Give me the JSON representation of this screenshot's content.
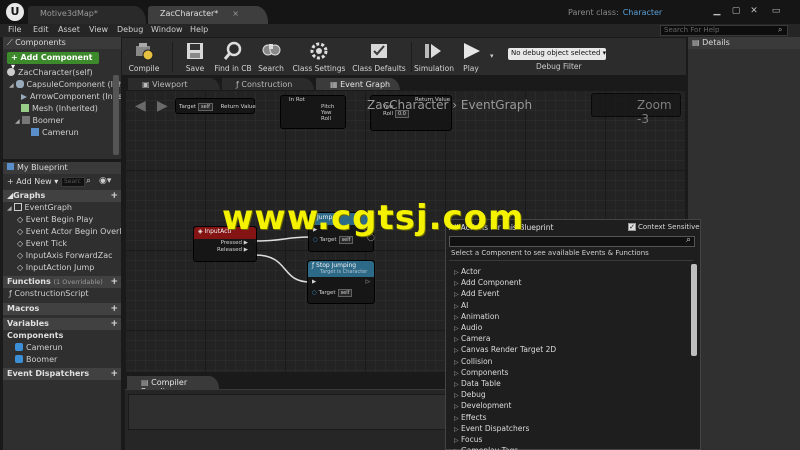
{
  "titlebar": {
    "tabs": [
      {
        "label": "Motive3dMap*"
      },
      {
        "label": "ZacCharacter*"
      }
    ],
    "parent_class_label": "Parent class:",
    "parent_class_value": "Character",
    "window_buttons": [
      "minimize-icon",
      "restore-icon",
      "close-icon"
    ]
  },
  "menubar": {
    "items": [
      "File",
      "Edit",
      "Asset",
      "View",
      "Debug",
      "Window",
      "Help"
    ],
    "search_placeholder": "Search For Help"
  },
  "components_panel": {
    "title": "Components",
    "add_button": "+ Add Component ▾",
    "items": [
      "ZacCharacter(self)",
      "CapsuleComponent (Inher",
      "ArrowComponent (Inher",
      "Mesh (Inherited)",
      "Boomer",
      "Camerun"
    ]
  },
  "my_blueprint": {
    "title": "My Blueprint",
    "add_new": "+ Add New ▾",
    "search_placeholder": "Searc",
    "sections": {
      "graphs": "Graphs",
      "graph_items": [
        "EventGraph",
        "Event Begin Play",
        "Event Actor Begin Overla",
        "Event Tick",
        "InputAxis ForwardZac",
        "InputAction Jump"
      ],
      "functions": "Functions",
      "functions_note": "(1 Overridable)",
      "function_items": [
        "ConstructionScript"
      ],
      "macros": "Macros",
      "variables": "Variables",
      "components": "Components",
      "component_vars": [
        "Camerun",
        "Boomer"
      ],
      "event_dispatchers": "Event Dispatchers"
    }
  },
  "toolbar": {
    "buttons": [
      {
        "label": "Compile",
        "icon": "compile-icon"
      },
      {
        "label": "Save",
        "icon": "save-icon"
      },
      {
        "label": "Find in CB",
        "icon": "find-icon"
      },
      {
        "label": "Search",
        "icon": "search-icon"
      },
      {
        "label": "Class Settings",
        "icon": "gear-icon"
      },
      {
        "label": "Class Defaults",
        "icon": "defaults-icon"
      },
      {
        "label": "Simulation",
        "icon": "simulation-icon"
      },
      {
        "label": "Play",
        "icon": "play-icon"
      }
    ],
    "debug_select": "No debug object selected ▾",
    "debug_filter": "Debug Filter"
  },
  "details": {
    "title": "Details"
  },
  "graph_tabs": [
    {
      "label": "Viewport"
    },
    {
      "label": "Construction Script"
    },
    {
      "label": "Event Graph"
    }
  ],
  "graph": {
    "breadcrumb_root": "ZacCharacter",
    "breadcrumb_sep": "›",
    "breadcrumb_leaf": "EventGraph",
    "zoom": "Zoom -3",
    "nodes": {
      "input_action": {
        "title": "InputActi",
        "pins": [
          "Pressed",
          "Released"
        ]
      },
      "jump": {
        "title": "Jump",
        "target": "Target",
        "self": "self"
      },
      "stop_jumping": {
        "title": "Stop Jumping",
        "subtitle": "Target is Character",
        "target": "Target",
        "self": "self"
      },
      "top_left": {
        "pin1": "Target",
        "self": "self",
        "return": "Return Value"
      },
      "top_mid": {
        "pins": [
          "In Rot",
          "Pitch",
          "Yaw",
          "Roll"
        ]
      },
      "top_right": {
        "pins": [
          "Yaw",
          "Roll"
        ],
        "return": "Return Value",
        "val": "0.0"
      }
    }
  },
  "compiler": {
    "title": "Compiler Results"
  },
  "action_menu": {
    "title": "All Actions for this Blueprint",
    "context_label": "Context Sensitive",
    "search_value": "",
    "hint": "Select a Component to see available Events & Functions",
    "items": [
      "Actor",
      "Add Component",
      "Add Event",
      "AI",
      "Animation",
      "Audio",
      "Camera",
      "Canvas Render Target 2D",
      "Collision",
      "Components",
      "Data Table",
      "Debug",
      "Development",
      "Effects",
      "Event Dispatchers",
      "Focus",
      "Gameplay Tags"
    ]
  },
  "watermark": "www.cgtsj.com"
}
